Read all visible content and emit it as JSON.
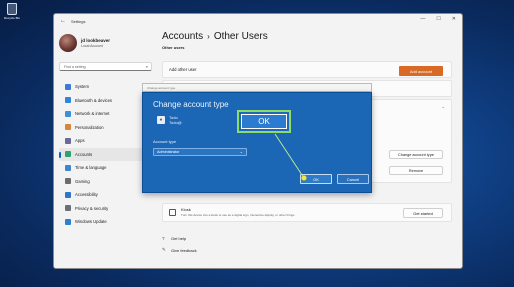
{
  "desktop": {
    "recycle_bin_label": "Recycle Bin"
  },
  "window": {
    "title": "Settings",
    "back_glyph": "←",
    "controls": [
      "—",
      "☐",
      "✕"
    ]
  },
  "profile": {
    "name": "jd lookbeaver",
    "account_type": "Local Account"
  },
  "search": {
    "placeholder": "Find a setting",
    "icon_glyph": "⌕"
  },
  "nav": {
    "items": [
      {
        "label": "System",
        "color": "#3a7bd5"
      },
      {
        "label": "Bluetooth & devices",
        "color": "#2f86d6"
      },
      {
        "label": "Network & internet",
        "color": "#3c8fd8"
      },
      {
        "label": "Personalization",
        "color": "#d8843a"
      },
      {
        "label": "Apps",
        "color": "#6a6a9a"
      },
      {
        "label": "Accounts",
        "color": "#2fa36b"
      },
      {
        "label": "Time & language",
        "color": "#3a87d0"
      },
      {
        "label": "Gaming",
        "color": "#6b6b6b"
      },
      {
        "label": "Accessibility",
        "color": "#2d76c8"
      },
      {
        "label": "Privacy & security",
        "color": "#6b7078"
      },
      {
        "label": "Windows Update",
        "color": "#2f7fd1"
      }
    ]
  },
  "main": {
    "breadcrumb_parent": "Accounts",
    "breadcrumb_sep": "›",
    "breadcrumb_current": "Other Users",
    "section_label": "Other users",
    "add_other_user_label": "Add other user",
    "add_account_button": "Add account",
    "chevron_glyph": "⌃",
    "change_account_type_button": "Change account type",
    "remove_button": "Remove",
    "kiosk_title": "Kiosk",
    "kiosk_desc": "Turn this device into a kiosk to use as a digital sign, interactive display, or other things",
    "get_started_button": "Get started",
    "get_help_label": "Get help",
    "give_feedback_label": "Give feedback"
  },
  "dialog": {
    "top_bar": "Change account type",
    "title": "Change account type",
    "user_line1": "Todo",
    "user_line2": "Todo@",
    "account_type_label": "Account type",
    "account_type_value": "Administrator",
    "caret_glyph": "⌄",
    "ok_button": "OK",
    "cancel_button": "Cancel"
  },
  "callout": {
    "label": "OK"
  }
}
